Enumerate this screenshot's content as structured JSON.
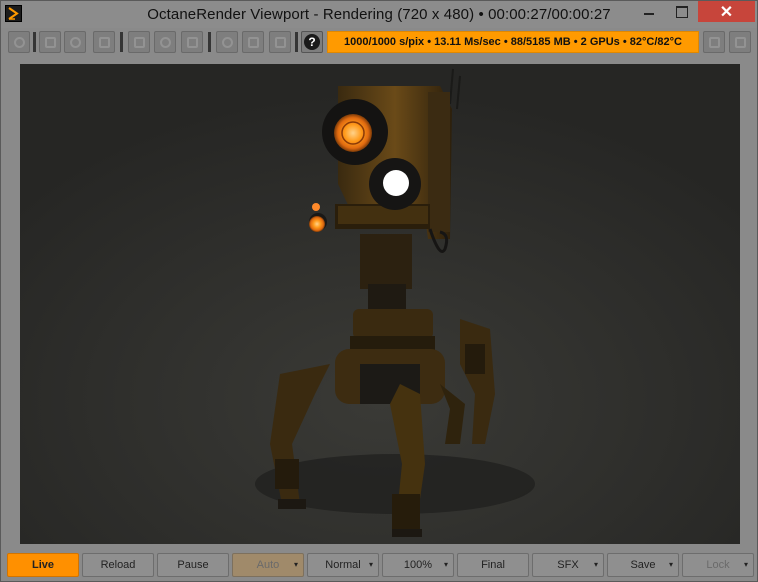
{
  "window": {
    "title": "OctaneRender Viewport - Rendering (720 x 480) • 00:00:27/00:00:27",
    "close_glyph": "✕"
  },
  "toolbar": {
    "help_label": "?",
    "status_text": "1000/1000 s/pix • 13.11 Ms/sec • 88/5185 MB • 2 GPUs • 82°C/82°C"
  },
  "bottom_bar": {
    "live_label": "Live",
    "reload_label": "Reload",
    "pause_label": "Pause",
    "auto_label": "Auto",
    "mode_label": "Normal",
    "zoom_label": "100%",
    "final_label": "Final",
    "sfx_label": "SFX",
    "save_label": "Save",
    "lock_label": "Lock",
    "caret_glyph": "▾"
  },
  "colors": {
    "accent_orange": "#ff9a00",
    "close_red": "#c7453b",
    "viewport_bg": "#2b2b28"
  }
}
